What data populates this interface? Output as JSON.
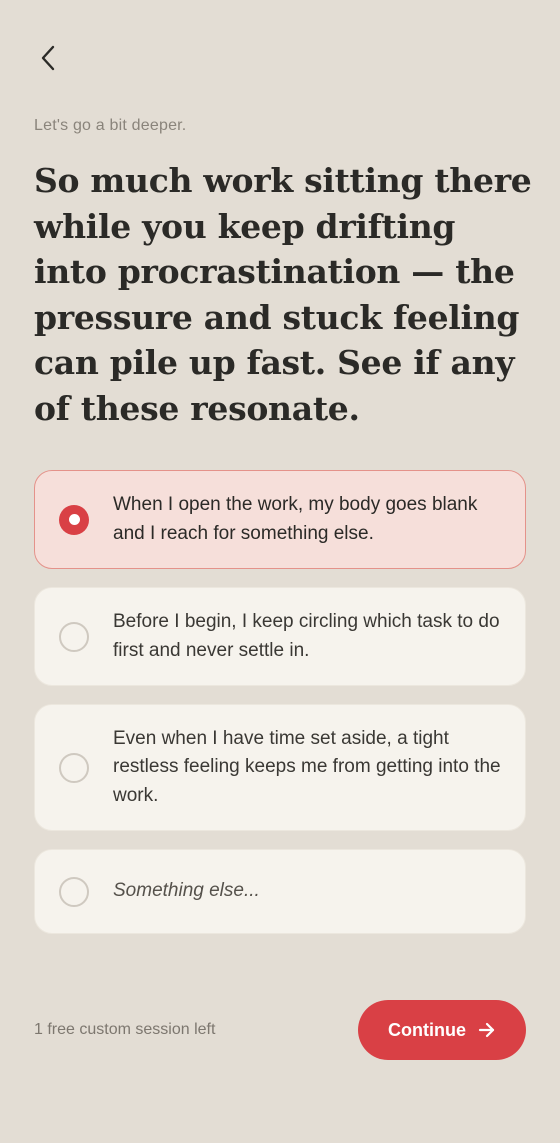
{
  "header": {
    "back_icon": "chevron-left-icon"
  },
  "intro": {
    "subtitle": "Let's go a bit deeper.",
    "headline": "So much work sitting there while you keep drifting into procrastination — the pressure and stuck feeling can pile up fast. See if any of these resonate."
  },
  "options": [
    {
      "label": "When I open the work, my body goes blank and I reach for something else.",
      "selected": true
    },
    {
      "label": "Before I begin, I keep circling which task to do first and never settle in.",
      "selected": false
    },
    {
      "label": "Even when I have time set aside, a tight restless feeling keeps me from getting into the work.",
      "selected": false
    },
    {
      "label": "Something else...",
      "selected": false
    }
  ],
  "footer": {
    "note": "1 free custom session left",
    "continue_label": "Continue",
    "continue_icon": "arrow-right-icon"
  },
  "colors": {
    "background": "#e3ddd4",
    "accent": "#d94045",
    "selected_card": "#f6dfda",
    "card": "#f6f3ed"
  }
}
